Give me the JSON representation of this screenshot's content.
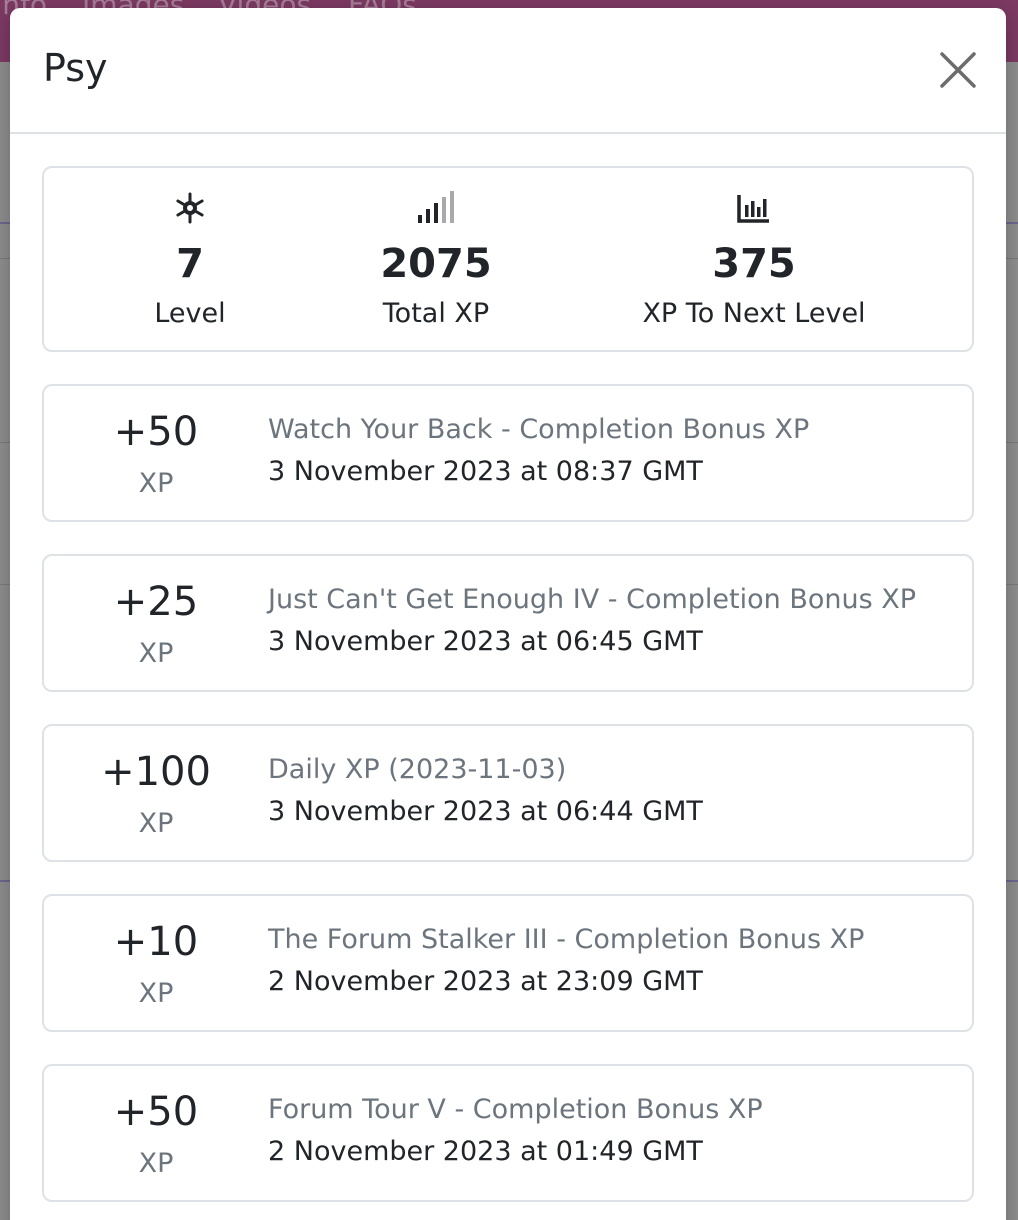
{
  "background": {
    "nav_items": [
      "Info",
      "Images",
      "Videos",
      "FAQs"
    ]
  },
  "modal": {
    "title": "Psy",
    "close_icon": "close-icon"
  },
  "stats": [
    {
      "icon": "gear-icon",
      "value": "7",
      "label": "Level"
    },
    {
      "icon": "signal-bars-icon",
      "value": "2075",
      "label": "Total XP"
    },
    {
      "icon": "bar-chart-icon",
      "value": "375",
      "label": "XP To Next Level"
    }
  ],
  "xp_history": [
    {
      "amount": "+50",
      "unit": "XP",
      "description": "Watch Your Back - Completion Bonus XP",
      "date": "3 November 2023 at 08:37 GMT"
    },
    {
      "amount": "+25",
      "unit": "XP",
      "description": "Just Can't Get Enough IV - Completion Bonus XP",
      "date": "3 November 2023 at 06:45 GMT"
    },
    {
      "amount": "+100",
      "unit": "XP",
      "description": "Daily XP (2023-11-03)",
      "date": "3 November 2023 at 06:44 GMT"
    },
    {
      "amount": "+10",
      "unit": "XP",
      "description": "The Forum Stalker III - Completion Bonus XP",
      "date": "2 November 2023 at 23:09 GMT"
    },
    {
      "amount": "+50",
      "unit": "XP",
      "description": "Forum Tour V - Completion Bonus XP",
      "date": "2 November 2023 at 01:49 GMT"
    }
  ]
}
